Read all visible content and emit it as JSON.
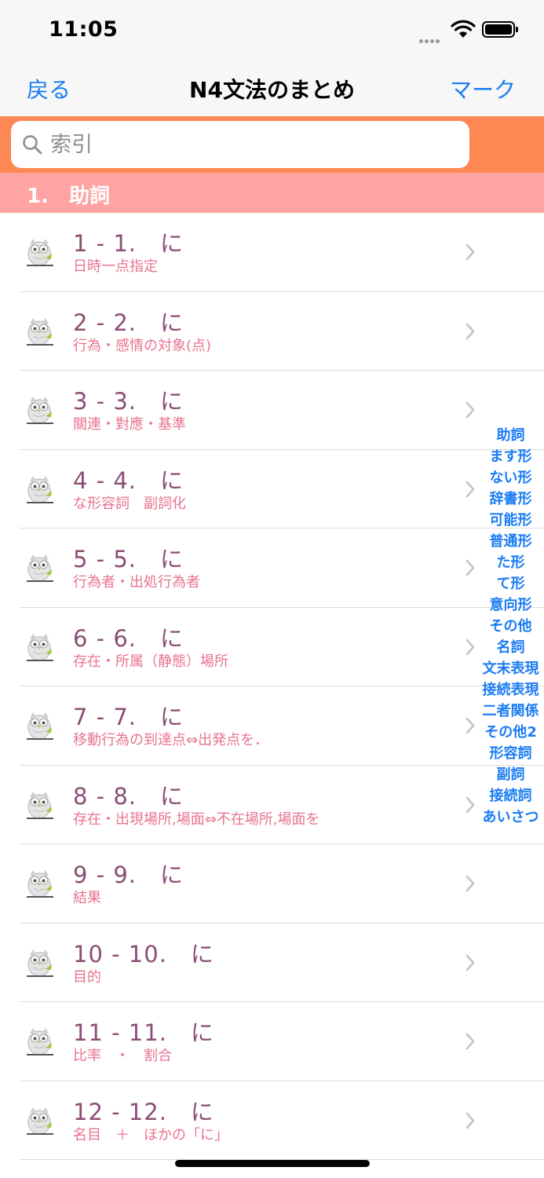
{
  "status": {
    "time": "11:05"
  },
  "nav": {
    "back": "戻る",
    "title": "N4文法のまとめ",
    "mark": "マーク"
  },
  "search": {
    "placeholder": "索引"
  },
  "section": {
    "title": "1.　助詞"
  },
  "rows": [
    {
      "title": "1 - 1.　に",
      "subtitle": "日時一点指定"
    },
    {
      "title": "2 - 2.　に",
      "subtitle": "行為・感情の対象(点)"
    },
    {
      "title": "3 - 3.　に",
      "subtitle": "關連・對應・基準"
    },
    {
      "title": "4 - 4.　に",
      "subtitle": "な形容詞　副詞化"
    },
    {
      "title": "5 - 5.　に",
      "subtitle": "行為者・出処行為者"
    },
    {
      "title": "6 - 6.　に",
      "subtitle": "存在・所属（静態）場所"
    },
    {
      "title": "7 - 7.　に",
      "subtitle": "移動行為の到達点⇔出発点を．"
    },
    {
      "title": "8 - 8.　に",
      "subtitle": "存在・出現場所,場面⇔不在場所,場面を"
    },
    {
      "title": "9 - 9.　に",
      "subtitle": "結果"
    },
    {
      "title": "10 - 10.　に",
      "subtitle": "目的"
    },
    {
      "title": "11 - 11.　に",
      "subtitle": "比率　・　割合"
    },
    {
      "title": "12 - 12.　に",
      "subtitle": "名目　＋　ほかの「に」"
    }
  ],
  "index": [
    "助詞",
    "ます形",
    "ない形",
    "辞書形",
    "可能形",
    "普通形",
    "た形",
    "て形",
    "意向形",
    "その他",
    "名詞",
    "文末表現",
    "接続表現",
    "二者関係",
    "その他2",
    "形容詞",
    "副詞",
    "接続詞",
    "あいさつ"
  ],
  "colors": {
    "accent": "#1a7cf3",
    "search_bar": "#fd8853",
    "section_header": "#ffa3a3",
    "row_title": "#8b4d74",
    "row_subtitle": "#e8738f"
  }
}
